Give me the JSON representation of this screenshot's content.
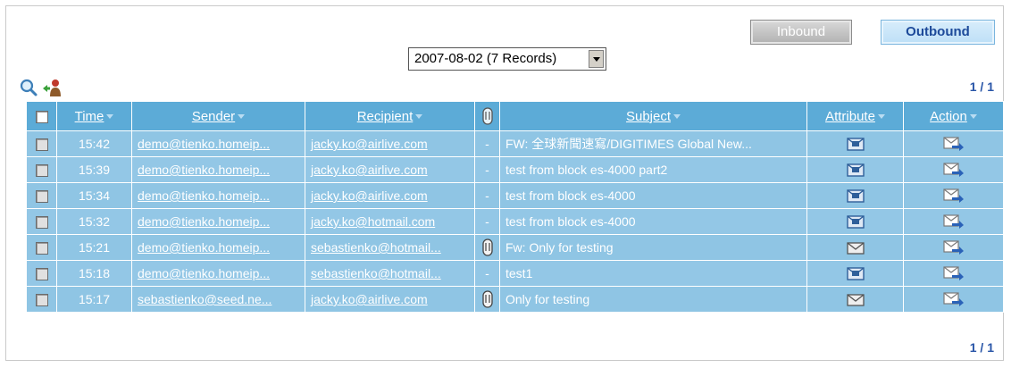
{
  "tabs": {
    "inbound": "Inbound",
    "outbound": "Outbound"
  },
  "date_select": {
    "value": "2007-08-02 (7 Records)"
  },
  "pager": {
    "top": "1 / 1",
    "bottom": "1 / 1"
  },
  "columns": {
    "time": "Time",
    "sender": "Sender",
    "recipient": "Recipient",
    "subject": "Subject",
    "attribute": "Attribute",
    "action": "Action"
  },
  "rows": [
    {
      "time": "15:42",
      "sender": "demo@tienko.homeip...",
      "recipient": "jacky.ko@airlive.com",
      "attach": "-",
      "subject": "FW: 全球新聞速寫/DIGITIMES Global New...",
      "attribute": "flagged-envelope"
    },
    {
      "time": "15:39",
      "sender": "demo@tienko.homeip...",
      "recipient": "jacky.ko@airlive.com",
      "attach": "-",
      "subject": "test from block es-4000 part2",
      "attribute": "flagged-envelope"
    },
    {
      "time": "15:34",
      "sender": "demo@tienko.homeip...",
      "recipient": "jacky.ko@airlive.com",
      "attach": "-",
      "subject": "test from block es-4000",
      "attribute": "flagged-envelope"
    },
    {
      "time": "15:32",
      "sender": "demo@tienko.homeip...",
      "recipient": "jacky.ko@hotmail.com",
      "attach": "-",
      "subject": "test from block es-4000",
      "attribute": "flagged-envelope"
    },
    {
      "time": "15:21",
      "sender": "demo@tienko.homeip...",
      "recipient": "sebastienko@hotmail...",
      "attach": "paperclip",
      "subject": "Fw: Only for testing",
      "attribute": "envelope"
    },
    {
      "time": "15:18",
      "sender": "demo@tienko.homeip...",
      "recipient": "sebastienko@hotmail...",
      "attach": "-",
      "subject": "test1",
      "attribute": "flagged-envelope"
    },
    {
      "time": "15:17",
      "sender": "sebastienko@seed.ne...",
      "recipient": "jacky.ko@airlive.com",
      "attach": "paperclip",
      "subject": "Only for testing",
      "attribute": "envelope"
    }
  ],
  "icons": {
    "search": "magnifier-icon",
    "user": "user-arrow-icon",
    "attach_header": "paperclip-icon",
    "action": "forward-mail-icon"
  }
}
